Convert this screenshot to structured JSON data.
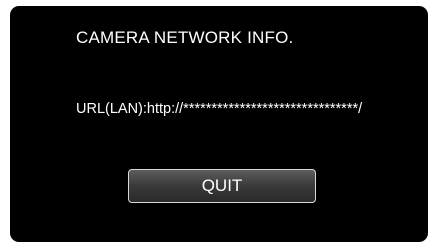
{
  "header": {
    "title": "CAMERA NETWORK INFO."
  },
  "info": {
    "url_line": "URL(LAN):http://*******************************/"
  },
  "actions": {
    "quit_label": "QUIT"
  },
  "colors": {
    "background": "#000000",
    "text": "#ffffff",
    "button_border": "#d8d8d8",
    "page": "#ffffff"
  }
}
